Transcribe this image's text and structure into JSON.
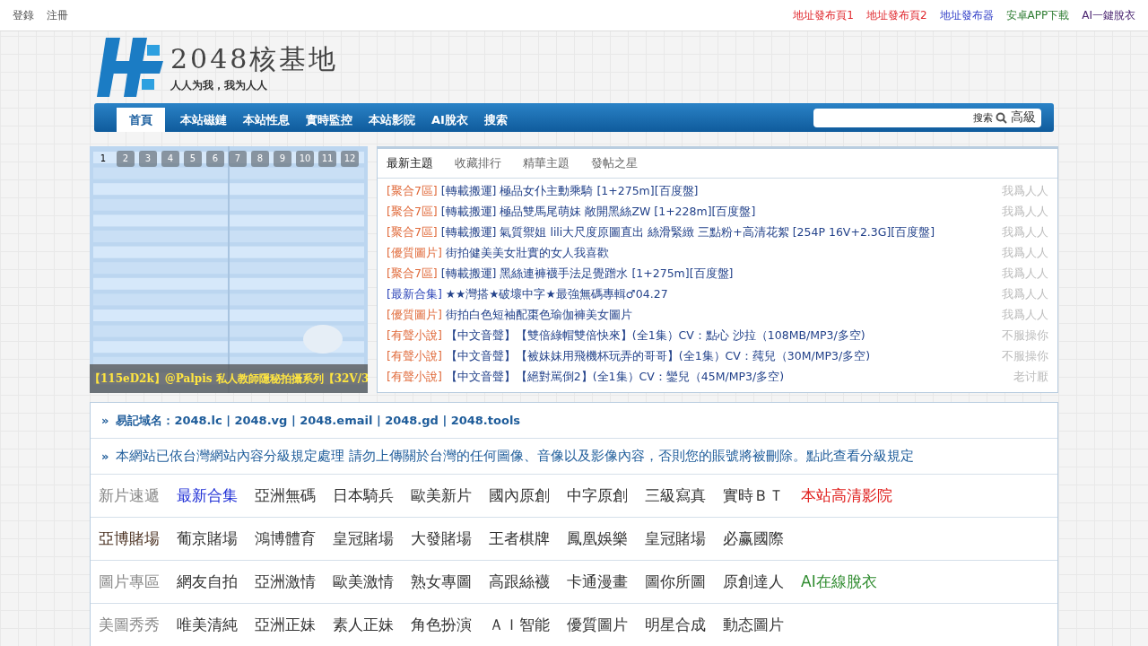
{
  "top_bar": {
    "left": [
      {
        "label": "登錄"
      },
      {
        "label": "注冊"
      }
    ],
    "right": [
      {
        "label": "地址發布頁1",
        "color": "#e0282e"
      },
      {
        "label": "地址發布頁2",
        "color": "#e0282e"
      },
      {
        "label": "地址發布器",
        "color": "#3340c8"
      },
      {
        "label": "安卓APP下載",
        "color": "#2e7d32"
      },
      {
        "label": "AI一鍵脫衣",
        "color": "#4a2470"
      }
    ]
  },
  "logo": {
    "title": "2048核基地",
    "slogan": "人人为我，我为人人"
  },
  "nav": {
    "items": [
      {
        "label": "首頁",
        "selected": true
      },
      {
        "label": "本站磁鏈",
        "selected": false
      },
      {
        "label": "本站性息",
        "selected": false
      },
      {
        "label": "實時監控",
        "selected": false
      },
      {
        "label": "本站影院",
        "selected": false
      },
      {
        "label": "AI脫衣",
        "selected": false
      },
      {
        "label": "搜索",
        "selected": false
      }
    ],
    "search": {
      "button": "搜索",
      "advanced": "高級"
    }
  },
  "slideshow": {
    "kind": "picture",
    "pages": [
      {
        "label": "1",
        "selected": true
      },
      {
        "label": "2",
        "selected": false
      },
      {
        "label": "3",
        "selected": false
      },
      {
        "label": "4",
        "selected": false
      },
      {
        "label": "5",
        "selected": false
      },
      {
        "label": "6",
        "selected": false
      },
      {
        "label": "7",
        "selected": false
      },
      {
        "label": "8",
        "selected": false
      },
      {
        "label": "9",
        "selected": false
      },
      {
        "label": "10",
        "selected": false
      },
      {
        "label": "11",
        "selected": false
      },
      {
        "label": "12",
        "selected": false
      }
    ],
    "caption": "【115eD2k】@Palpis 私人教師隱秘拍攝系列【32V/3"
  },
  "topics": {
    "tabs": [
      {
        "label": "最新主題",
        "selected": true
      },
      {
        "label": "收藏排行",
        "selected": false
      },
      {
        "label": "精華主題",
        "selected": false
      },
      {
        "label": "發帖之星",
        "selected": false
      }
    ],
    "rows": [
      {
        "category": "[聚合7區]",
        "color": "#e06a3a",
        "title": "[轉載搬運] 極品女仆主動乘騎 [1+275m][百度盤]",
        "author": "我爲人人"
      },
      {
        "category": "[聚合7區]",
        "color": "#e06a3a",
        "title": "[轉載搬運] 極品雙馬尾萌妹 敞開黑絲ZW [1+228m][百度盤]",
        "author": "我爲人人"
      },
      {
        "category": "[聚合7區]",
        "color": "#e06a3a",
        "title": "[轉載搬運] 氣質禦姐 lili大尺度原圖直出 絲滑緊緻 三點粉+高清花絮 [254P 16V+2.3G][百度盤]",
        "author": "我爲人人"
      },
      {
        "category": "[優質圖片]",
        "color": "#e06a3a",
        "title": "街拍健美美女壯實的女人我喜歡",
        "author": "我爲人人"
      },
      {
        "category": "[聚合7區]",
        "color": "#e06a3a",
        "title": "[轉載搬運] 黑絲連褲襪手法足覺蹭水 [1+275m][百度盤]",
        "author": "我爲人人"
      },
      {
        "category": "[最新合集]",
        "color": "#2c44b8",
        "title": "★★灣搭★破壞中字★最強無碼專輯♂04.27",
        "author": "我爲人人"
      },
      {
        "category": "[優質圖片]",
        "color": "#e06a3a",
        "title": "街拍白色短袖配棗色瑜伽褲美女圖片",
        "author": "我爲人人"
      },
      {
        "category": "[有聲小說]",
        "color": "#e06a3a",
        "title": "【中文音聲】【雙倍綠帽雙倍快來】(全1集）CV：點心 沙拉（108MB/MP3/多空)",
        "author": "不服操你"
      },
      {
        "category": "[有聲小說]",
        "color": "#e06a3a",
        "title": "【中文音聲】【被妹妹用飛機杯玩弄的哥哥】(全1集）CV：莼兒（30M/MP3/多空)",
        "author": "不服操你"
      },
      {
        "category": "[有聲小說]",
        "color": "#e06a3a",
        "title": "【中文音聲】【絕對駡倒2】(全1集）CV：鑾兒（45M/MP3/多空)",
        "author": "老讨厭"
      }
    ]
  },
  "links_box": {
    "marker": "»",
    "domains": "易記域名：2048.lc | 2048.vg | 2048.email | 2048.gd | 2048.tools",
    "notice": "本網站已依台灣網站內容分級規定處理 請勿上傳關於台灣的任何圖像、音像以及影像內容，否則您的賬號將被刪除。點此查看分級規定",
    "categories": [
      {
        "label": "新片速遞",
        "color": "#888888",
        "links": [
          {
            "label": "最新合集",
            "color": "#1f2fd6"
          },
          {
            "label": "亞洲無碼",
            "color": "#333333"
          },
          {
            "label": "日本騎兵",
            "color": "#333333"
          },
          {
            "label": "歐美新片",
            "color": "#333333"
          },
          {
            "label": "國內原創",
            "color": "#333333"
          },
          {
            "label": "中字原創",
            "color": "#333333"
          },
          {
            "label": "三級寫真",
            "color": "#333333"
          },
          {
            "label": "實時ＢＴ",
            "color": "#333333"
          },
          {
            "label": "本站高清影院",
            "color": "#e0201e"
          }
        ]
      },
      {
        "label": "亞博賭場",
        "color": "#4a3020",
        "links": [
          {
            "label": "葡京賭場",
            "color": "#333333"
          },
          {
            "label": "鴻博體育",
            "color": "#333333"
          },
          {
            "label": "皇冠賭場",
            "color": "#333333"
          },
          {
            "label": "大發賭場",
            "color": "#333333"
          },
          {
            "label": "王者棋牌",
            "color": "#333333"
          },
          {
            "label": "鳳凰娛樂",
            "color": "#333333"
          },
          {
            "label": "皇冠賭場",
            "color": "#333333"
          },
          {
            "label": "必赢國際",
            "color": "#333333"
          }
        ]
      },
      {
        "label": "圖片專區",
        "color": "#888888",
        "links": [
          {
            "label": "網友自拍",
            "color": "#333333"
          },
          {
            "label": "亞洲激情",
            "color": "#333333"
          },
          {
            "label": "歐美激情",
            "color": "#333333"
          },
          {
            "label": "熟女專圖",
            "color": "#333333"
          },
          {
            "label": "高跟絲襪",
            "color": "#333333"
          },
          {
            "label": "卡通漫畫",
            "color": "#333333"
          },
          {
            "label": "圖你所圖",
            "color": "#333333"
          },
          {
            "label": "原創達人",
            "color": "#333333"
          },
          {
            "label": "AI在線脫衣",
            "color": "#2e8b2e"
          }
        ]
      },
      {
        "label": "美圖秀秀",
        "color": "#888888",
        "links": [
          {
            "label": "唯美清純",
            "color": "#333333"
          },
          {
            "label": "亞洲正妹",
            "color": "#333333"
          },
          {
            "label": "素人正妹",
            "color": "#333333"
          },
          {
            "label": "角色扮演",
            "color": "#333333"
          },
          {
            "label": "ＡＩ智能",
            "color": "#333333"
          },
          {
            "label": "優質圖片",
            "color": "#333333"
          },
          {
            "label": "明星合成",
            "color": "#333333"
          },
          {
            "label": "動态圖片",
            "color": "#333333"
          }
        ]
      }
    ]
  }
}
